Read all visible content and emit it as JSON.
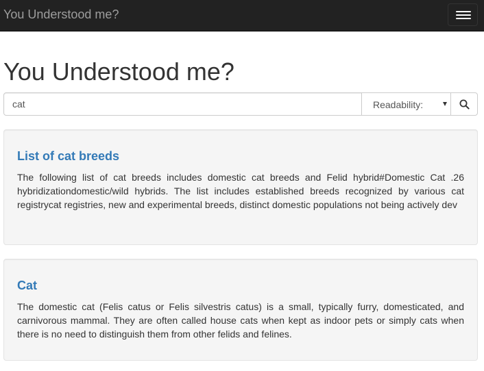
{
  "navbar": {
    "brand": "You Understood me?"
  },
  "main": {
    "title": "You Understood me?"
  },
  "search": {
    "value": "cat",
    "readability_label": "Readability:"
  },
  "results": [
    {
      "title": "List of cat breeds",
      "description": "The following list of cat breeds includes domestic cat breeds and Felid hybrid#Domestic Cat .26 hybridizationdomestic/wild hybrids. The list includes established breeds recognized by various cat registrycat registries, new and experimental breeds, distinct domestic populations not being actively dev"
    },
    {
      "title": "Cat",
      "description": "The domestic cat (Felis catus or Felis silvestris catus) is a small, typically furry, domesticated, and carnivorous mammal. They are often called house cats when kept as indoor pets or simply cats when there is no need to distinguish them from other felids and felines."
    }
  ]
}
